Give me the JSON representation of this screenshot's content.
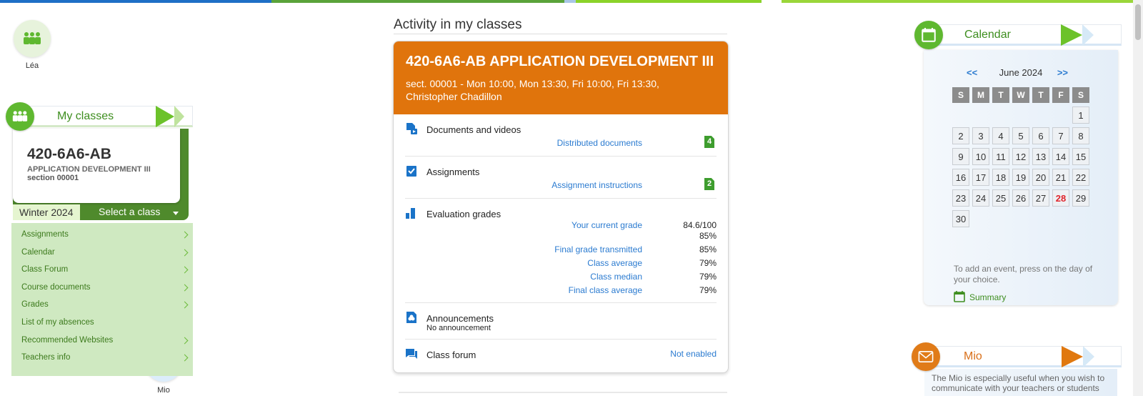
{
  "quick_access": [
    {
      "label": "Léa",
      "icon": "class-group-icon"
    },
    {
      "label": "Mio",
      "icon": "mail-icon"
    }
  ],
  "my_classes": {
    "title": "My classes",
    "course_code": "420-6A6-AB",
    "course_name": "APPLICATION DEVELOPMENT III",
    "section": "section 00001",
    "term": "Winter 2024",
    "select_label": "Select a class",
    "menu": [
      {
        "label": "Assignments",
        "arrow": true
      },
      {
        "label": "Calendar",
        "arrow": true
      },
      {
        "label": "Class Forum",
        "arrow": true
      },
      {
        "label": "Course documents",
        "arrow": true
      },
      {
        "label": "Grades",
        "arrow": true
      },
      {
        "label": "List of my absences",
        "arrow": false
      },
      {
        "label": "Recommended Websites",
        "arrow": true
      },
      {
        "label": "Teachers info",
        "arrow": true
      }
    ]
  },
  "activity": {
    "heading": "Activity in my classes",
    "course_title": "420-6A6-AB APPLICATION DEVELOPMENT III",
    "course_subtitle": "sect. 00001 - Mon 10:00, Mon 13:30, Fri 10:00, Fri 13:30, Christopher Chadillon",
    "documents": {
      "title": "Documents and videos",
      "link": "Distributed documents",
      "count": "4"
    },
    "assignments": {
      "title": "Assignments",
      "link": "Assignment instructions",
      "count": "2"
    },
    "grades": {
      "title": "Evaluation grades",
      "rows": [
        {
          "label": "Your current grade",
          "value": "84.6/100",
          "value2": "85%"
        },
        {
          "label": "Final grade transmitted",
          "value": "85%"
        },
        {
          "label": "Class average",
          "value": "79%"
        },
        {
          "label": "Class median",
          "value": "79%"
        },
        {
          "label": "Final class average",
          "value": "79%"
        }
      ]
    },
    "announcements": {
      "title": "Announcements",
      "note": "No announcement"
    },
    "forum": {
      "title": "Class forum",
      "status": "Not enabled"
    }
  },
  "calendar": {
    "title": "Calendar",
    "prev": "<<",
    "next": ">>",
    "month": "June 2024",
    "weekdays": [
      "S",
      "M",
      "T",
      "W",
      "T",
      "F",
      "S"
    ],
    "first_weekday_index": 6,
    "days_in_month": 30,
    "today": 28,
    "hint": "To add an event, press on the day of your choice.",
    "summary_label": "Summary"
  },
  "mio": {
    "title": "Mio",
    "text": "The Mio is especially useful when you wish to communicate with your teachers or students"
  },
  "colors": {
    "green_accent": "#5fb830",
    "orange_course": "#e0740c",
    "link_blue": "#2b7bd0",
    "today_red": "#e0242b"
  }
}
